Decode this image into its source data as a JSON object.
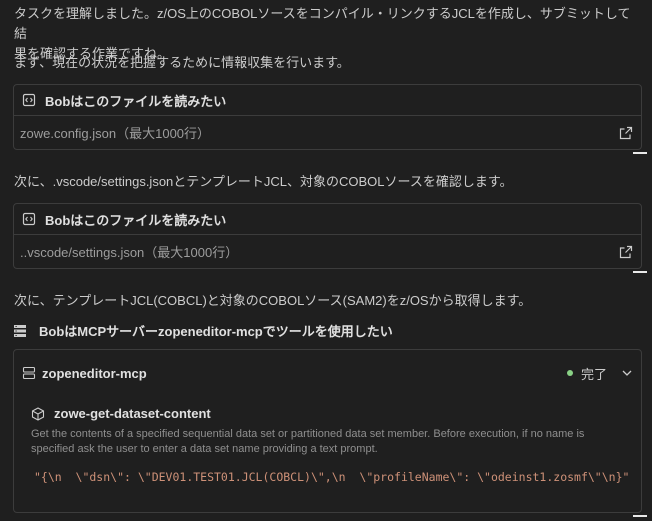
{
  "intro": {
    "line1": "タスクを理解しました。z/OS上のCOBOLソースをコンパイル・リンクするJCLを作成し、サブミットして結",
    "line2": "果を確認する作業ですね。",
    "line3": "まず、現在の状況を把握するために情報収集を行います。"
  },
  "read_cards": [
    {
      "title": "Bobはこのファイルを読みたい",
      "file": "zowe.config.json（最大1000行）",
      "open_icon": "external-link-icon"
    },
    {
      "title": "Bobはこのファイルを読みたい",
      "file": "..vscode/settings.json（最大1000行）",
      "open_icon": "external-link-icon"
    }
  ],
  "step2_text": "次に、.vscode/settings.jsonとテンプレートJCL、対象のCOBOLソースを確認します。",
  "step3_text": "次に、テンプレートJCL(COBCL)と対象のCOBOLソース(SAM2)をz/OSから取得します。",
  "tool_request": {
    "title": "BobはMCPサーバーzopeneditor-mcpでツールを使用したい",
    "icon": "server-icon"
  },
  "mcp": {
    "server_name": "zopeneditor-mcp",
    "status": "完了",
    "status_color": "#89d185",
    "function_name": "zowe-get-dataset-content",
    "description": "Get the contents of a specified sequential data set or partitioned data set member. Before execution, if no name is specified ask the user to enter a data set name providing a text prompt.",
    "arguments": "\"{\\n  \\\"dsn\\\": \\\"DEV01.TEST01.JCL(COBCL)\\\",\\n  \\\"profileName\\\": \\\"odeinst1.zosmf\\\"\\n}\""
  }
}
